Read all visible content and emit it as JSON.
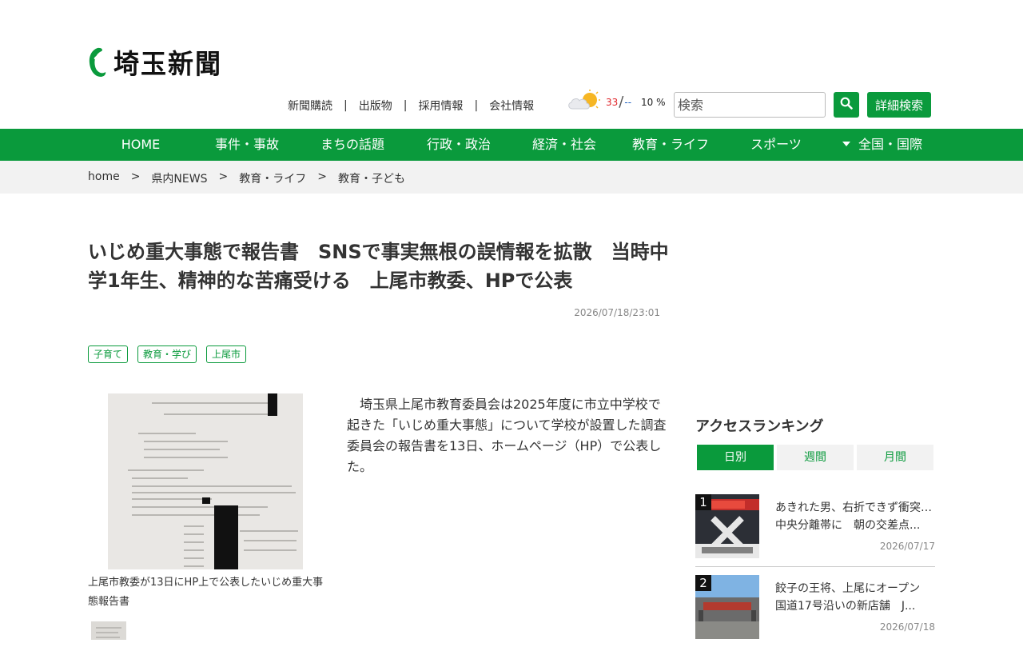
{
  "site": {
    "logo_text": "埼玉新聞"
  },
  "header": {
    "util_links": [
      "新聞購読",
      "出版物",
      "採用情報",
      "会社情報"
    ],
    "separator": "|",
    "weather": {
      "icon": "cloud-sun-icon",
      "high": "33",
      "slash": "/",
      "low": "--",
      "rain": "10 %"
    },
    "search": {
      "placeholder": "検索",
      "button_icon": "search-icon"
    },
    "advanced_search_label": "詳細検索"
  },
  "nav": {
    "items": [
      "HOME",
      "事件・事故",
      "まちの話題",
      "行政・政治",
      "経済・社会",
      "教育・ライフ",
      "スポーツ",
      "全国・国際"
    ]
  },
  "breadcrumb": {
    "items": [
      "home",
      "県内NEWS",
      "教育・ライフ",
      "教育・子ども"
    ],
    "separator": ">"
  },
  "article": {
    "title": "いじめ重大事態で報告書　SNSで事実無根の誤情報を拡散　当時中学1年生、精神的な苦痛受ける　上尾市教委、HPで公表",
    "date": "2026/07/18/23:01",
    "tags": [
      "子育て",
      "教育・学び",
      "上尾市"
    ],
    "photo_caption": "上尾市教委が13日にHP上で公表したいじめ重大事態報告書",
    "body": "　埼玉県上尾市教育委員会は2025年度に市立中学校で起きた「いじめ重大事態」について学校が設置した調査委員会の報告書を13日、ホームページ（HP）で公表した。"
  },
  "ranking": {
    "heading": "アクセスランキング",
    "tabs": [
      "日別",
      "週間",
      "月間"
    ],
    "active_tab": "日別",
    "items": [
      {
        "rank": "1",
        "title": "あきれた男、右折できず衝突…\n中央分離帯に　朝の交差点...",
        "date": "2026/07/17"
      },
      {
        "rank": "2",
        "title": "餃子の王将、上尾にオープン\n国道17号沿いの新店舗　J...",
        "date": "2026/07/18"
      }
    ]
  },
  "colors": {
    "brand_green": "#0a9a3c",
    "temp_high": "#e0262b",
    "temp_low": "#1f5fbf"
  }
}
